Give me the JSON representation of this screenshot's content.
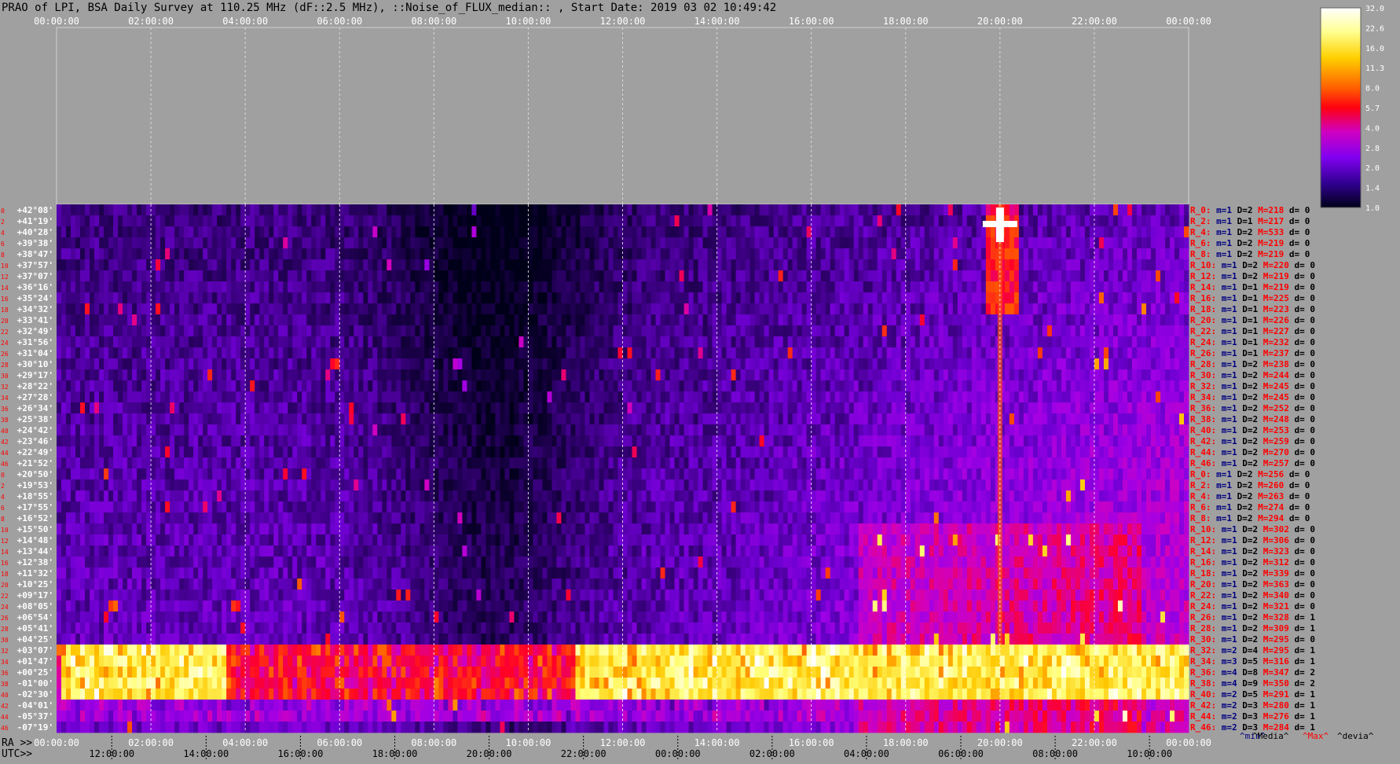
{
  "chart_data": {
    "type": "heatmap",
    "title": "PRAO of LPI, BSA Daily Survey at 110.25 MHz (dF::2.5 MHz), ::Noise_of_FLUX_median:: , Start Date: 2019 03 02 10:49:42",
    "top_axis_ticks": [
      "00:00:00",
      "02:00:00",
      "04:00:00",
      "06:00:00",
      "08:00:00",
      "10:00:00",
      "12:00:00",
      "14:00:00",
      "16:00:00",
      "18:00:00",
      "20:00:00",
      "22:00:00",
      "00:00:00"
    ],
    "ra_label": "RA >>",
    "ra_ticks": [
      "00:00:00",
      "02:00:00",
      "04:00:00",
      "06:00:00",
      "08:00:00",
      "10:00:00",
      "12:00:00",
      "14:00:00",
      "16:00:00",
      "18:00:00",
      "20:00:00",
      "22:00:00",
      "00:00:00"
    ],
    "utc_label": "UTC>>",
    "utc_ticks": [
      "12:00:00",
      "14:00:00",
      "16:00:00",
      "18:00:00",
      "20:00:00",
      "22:00:00",
      "00:00:00",
      "02:00:00",
      "04:00:00",
      "06:00:00",
      "08:00:00",
      "10:00:00"
    ],
    "colorbar": {
      "ticks": [
        "32.0",
        "22.6",
        "16.0",
        "11.3",
        "8.0",
        "5.7",
        "4.0",
        "2.8",
        "2.0",
        "1.4",
        "1.0"
      ],
      "scale": "log",
      "range": [
        1.0,
        32.0
      ]
    },
    "legend_codes": {
      "min": "^min^",
      "median": "^Media^",
      "max": "^Max^",
      "devia": "^devia^"
    },
    "row_index_labels": [
      "0",
      "2",
      "4",
      "6",
      "8",
      "10",
      "12",
      "14",
      "16",
      "18",
      "20",
      "22",
      "24",
      "26",
      "28",
      "30",
      "32",
      "34",
      "36",
      "38",
      "40",
      "42",
      "44",
      "46",
      "0",
      "2",
      "4",
      "6",
      "8",
      "10",
      "12",
      "14",
      "16",
      "18",
      "20",
      "22",
      "24",
      "26",
      "28",
      "30",
      "32",
      "34",
      "36",
      "38",
      "40",
      "42",
      "44",
      "46"
    ],
    "declinations": [
      "+42°08'",
      "+41°19'",
      "+40°28'",
      "+39°38'",
      "+38°47'",
      "+37°57'",
      "+37°07'",
      "+36°16'",
      "+35°24'",
      "+34°32'",
      "+33°41'",
      "+32°49'",
      "+31°56'",
      "+31°04'",
      "+30°10'",
      "+29°17'",
      "+28°22'",
      "+27°28'",
      "+26°34'",
      "+25°38'",
      "+24°42'",
      "+23°46'",
      "+22°49'",
      "+21°52'",
      "+20°50'",
      "+19°53'",
      "+18°55'",
      "+17°55'",
      "+16°52'",
      "+15°50'",
      "+14°48'",
      "+13°44'",
      "+12°38'",
      "+11°32'",
      "+10°25'",
      "+09°17'",
      "+08°05'",
      "+06°54'",
      "+05°41'",
      "+04°25'",
      "+03°07'",
      "+01°47'",
      "+00°25'",
      "-01°00'",
      "-02°30'",
      "-04°01'",
      "-05°37'",
      "-07°19'"
    ],
    "beam_stats": [
      {
        "r": "R_0:",
        "m": "m=1",
        "D": "D=2",
        "M": "M=218",
        "d": "d= 0"
      },
      {
        "r": "R_2:",
        "m": "m=1",
        "D": "D=1",
        "M": "M=217",
        "d": "d= 0"
      },
      {
        "r": "R_4:",
        "m": "m=1",
        "D": "D=2",
        "M": "M=533",
        "d": "d= 0"
      },
      {
        "r": "R_6:",
        "m": "m=1",
        "D": "D=2",
        "M": "M=219",
        "d": "d= 0"
      },
      {
        "r": "R_8:",
        "m": "m=1",
        "D": "D=2",
        "M": "M=219",
        "d": "d= 0"
      },
      {
        "r": "R_10:",
        "m": "m=1",
        "D": "D=2",
        "M": "M=220",
        "d": "d= 0"
      },
      {
        "r": "R_12:",
        "m": "m=1",
        "D": "D=2",
        "M": "M=219",
        "d": "d= 0"
      },
      {
        "r": "R_14:",
        "m": "m=1",
        "D": "D=1",
        "M": "M=219",
        "d": "d= 0"
      },
      {
        "r": "R_16:",
        "m": "m=1",
        "D": "D=1",
        "M": "M=225",
        "d": "d= 0"
      },
      {
        "r": "R_18:",
        "m": "m=1",
        "D": "D=1",
        "M": "M=223",
        "d": "d= 0"
      },
      {
        "r": "R_20:",
        "m": "m=1",
        "D": "D=1",
        "M": "M=226",
        "d": "d= 0"
      },
      {
        "r": "R_22:",
        "m": "m=1",
        "D": "D=1",
        "M": "M=227",
        "d": "d= 0"
      },
      {
        "r": "R_24:",
        "m": "m=1",
        "D": "D=1",
        "M": "M=232",
        "d": "d= 0"
      },
      {
        "r": "R_26:",
        "m": "m=1",
        "D": "D=1",
        "M": "M=237",
        "d": "d= 0"
      },
      {
        "r": "R_28:",
        "m": "m=1",
        "D": "D=2",
        "M": "M=238",
        "d": "d= 0"
      },
      {
        "r": "R_30:",
        "m": "m=1",
        "D": "D=2",
        "M": "M=244",
        "d": "d= 0"
      },
      {
        "r": "R_32:",
        "m": "m=1",
        "D": "D=2",
        "M": "M=245",
        "d": "d= 0"
      },
      {
        "r": "R_34:",
        "m": "m=1",
        "D": "D=2",
        "M": "M=245",
        "d": "d= 0"
      },
      {
        "r": "R_36:",
        "m": "m=1",
        "D": "D=2",
        "M": "M=252",
        "d": "d= 0"
      },
      {
        "r": "R_38:",
        "m": "m=1",
        "D": "D=2",
        "M": "M=248",
        "d": "d= 0"
      },
      {
        "r": "R_40:",
        "m": "m=1",
        "D": "D=2",
        "M": "M=253",
        "d": "d= 0"
      },
      {
        "r": "R_42:",
        "m": "m=1",
        "D": "D=2",
        "M": "M=259",
        "d": "d= 0"
      },
      {
        "r": "R_44:",
        "m": "m=1",
        "D": "D=2",
        "M": "M=270",
        "d": "d= 0"
      },
      {
        "r": "R_46:",
        "m": "m=1",
        "D": "D=2",
        "M": "M=257",
        "d": "d= 0"
      },
      {
        "r": "R_0:",
        "m": "m=1",
        "D": "D=2",
        "M": "M=256",
        "d": "d= 0"
      },
      {
        "r": "R_2:",
        "m": "m=1",
        "D": "D=2",
        "M": "M=260",
        "d": "d= 0"
      },
      {
        "r": "R_4:",
        "m": "m=1",
        "D": "D=2",
        "M": "M=263",
        "d": "d= 0"
      },
      {
        "r": "R_6:",
        "m": "m=1",
        "D": "D=2",
        "M": "M=274",
        "d": "d= 0"
      },
      {
        "r": "R_8:",
        "m": "m=1",
        "D": "D=2",
        "M": "M=294",
        "d": "d= 0"
      },
      {
        "r": "R_10:",
        "m": "m=1",
        "D": "D=2",
        "M": "M=302",
        "d": "d= 0"
      },
      {
        "r": "R_12:",
        "m": "m=1",
        "D": "D=2",
        "M": "M=306",
        "d": "d= 0"
      },
      {
        "r": "R_14:",
        "m": "m=1",
        "D": "D=2",
        "M": "M=323",
        "d": "d= 0"
      },
      {
        "r": "R_16:",
        "m": "m=1",
        "D": "D=2",
        "M": "M=312",
        "d": "d= 0"
      },
      {
        "r": "R_18:",
        "m": "m=1",
        "D": "D=2",
        "M": "M=339",
        "d": "d= 0"
      },
      {
        "r": "R_20:",
        "m": "m=1",
        "D": "D=2",
        "M": "M=363",
        "d": "d= 0"
      },
      {
        "r": "R_22:",
        "m": "m=1",
        "D": "D=2",
        "M": "M=340",
        "d": "d= 0"
      },
      {
        "r": "R_24:",
        "m": "m=1",
        "D": "D=2",
        "M": "M=321",
        "d": "d= 0"
      },
      {
        "r": "R_26:",
        "m": "m=1",
        "D": "D=2",
        "M": "M=328",
        "d": "d= 1"
      },
      {
        "r": "R_28:",
        "m": "m=1",
        "D": "D=2",
        "M": "M=309",
        "d": "d= 1"
      },
      {
        "r": "R_30:",
        "m": "m=1",
        "D": "D=2",
        "M": "M=295",
        "d": "d= 0"
      },
      {
        "r": "R_32:",
        "m": "m=2",
        "D": "D=4",
        "M": "M=295",
        "d": "d= 1"
      },
      {
        "r": "R_34:",
        "m": "m=3",
        "D": "D=5",
        "M": "M=316",
        "d": "d= 1"
      },
      {
        "r": "R_36:",
        "m": "m=4",
        "D": "D=8",
        "M": "M=347",
        "d": "d= 2"
      },
      {
        "r": "R_38:",
        "m": "m=4",
        "D": "D=9",
        "M": "M=350",
        "d": "d= 2"
      },
      {
        "r": "R_40:",
        "m": "m=2",
        "D": "D=5",
        "M": "M=291",
        "d": "d= 1"
      },
      {
        "r": "R_42:",
        "m": "m=2",
        "D": "D=3",
        "M": "M=280",
        "d": "d= 1"
      },
      {
        "r": "R_44:",
        "m": "m=2",
        "D": "D=3",
        "M": "M=276",
        "d": "d= 1"
      },
      {
        "r": "R_46:",
        "m": "m=2",
        "D": "D=3",
        "M": "M=284",
        "d": "d= 1"
      }
    ],
    "colors": {
      "background": "#a0a0a0",
      "title_text": "#000000",
      "index_label": "#ff0000",
      "stats_min": "#000080",
      "stats_max": "#ff0000",
      "stats_other": "#000000"
    },
    "features": [
      {
        "kind": "bright_band",
        "dec_rows": [
          40,
          44
        ],
        "ra_range_h": [
          0,
          24
        ],
        "level": "high"
      },
      {
        "kind": "sun_track",
        "ra_h": 20.0,
        "dec_rows": [
          0,
          40
        ],
        "level": "high"
      },
      {
        "kind": "quiet_region",
        "ra_range_h": [
          8,
          12
        ],
        "level": "low"
      }
    ]
  }
}
